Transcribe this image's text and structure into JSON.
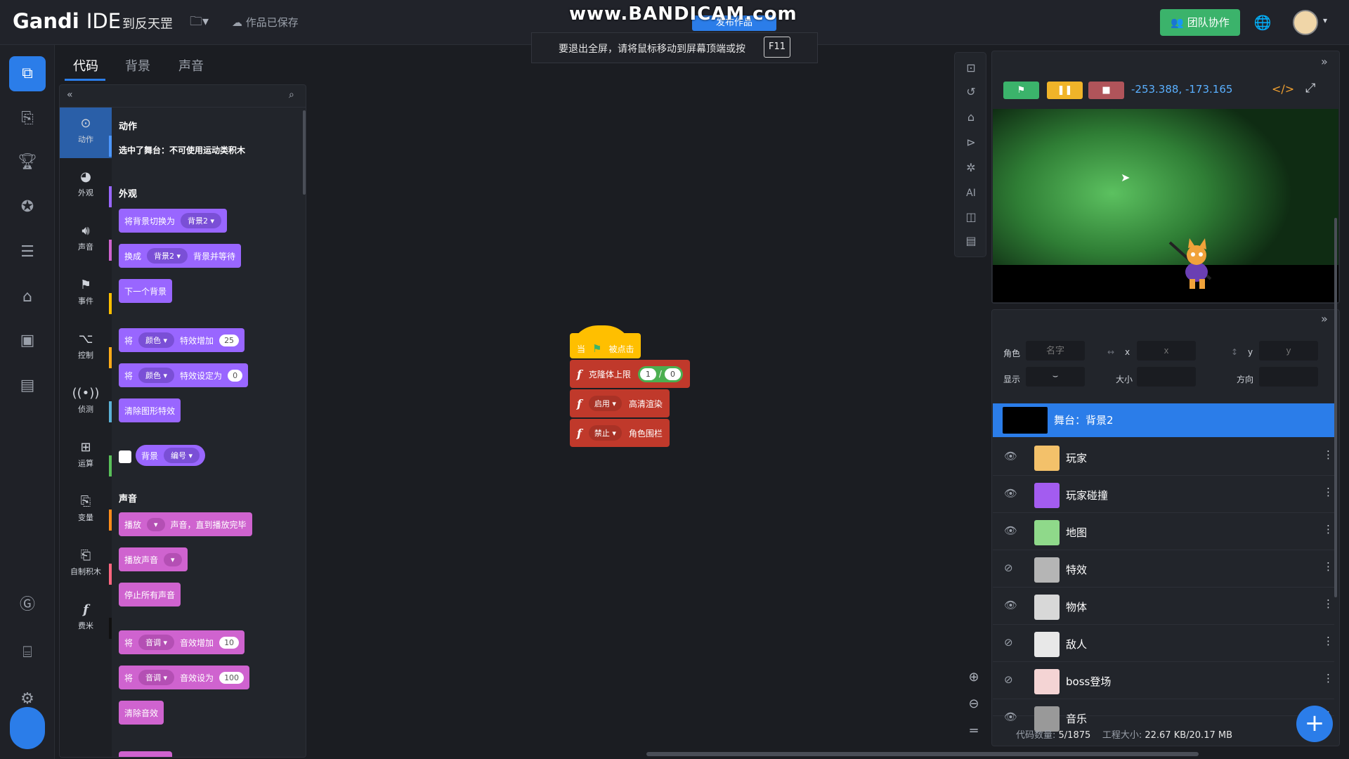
{
  "topbar": {
    "logo_main": "Gandi",
    "logo_sub": "IDE",
    "project_name": "到反天罡",
    "save_status": "作品已保存",
    "watermark": "www.BANDICAM.com",
    "publish_label": "发布作品",
    "fullscreen_tip": "要退出全屏，请将鼠标移动到屏幕顶端或按",
    "fullscreen_key": "F11",
    "team_button": "团队协作"
  },
  "tabs": [
    "代码",
    "背景",
    "声音"
  ],
  "palette": {
    "categories": [
      {
        "label": "动作",
        "icon": "motion-icon",
        "color": "#4c97ff"
      },
      {
        "label": "外观",
        "icon": "looks-icon",
        "color": "#9966ff"
      },
      {
        "label": "声音",
        "icon": "sound-icon",
        "color": "#cf63cf"
      },
      {
        "label": "事件",
        "icon": "events-icon",
        "color": "#ffbf00"
      },
      {
        "label": "控制",
        "icon": "control-icon",
        "color": "#ffab19"
      },
      {
        "label": "侦测",
        "icon": "sensing-icon",
        "color": "#5cb1d6"
      },
      {
        "label": "运算",
        "icon": "operators-icon",
        "color": "#59c059"
      },
      {
        "label": "变量",
        "icon": "variables-icon",
        "color": "#ff8c1a"
      },
      {
        "label": "自制积木",
        "icon": "myblocks-icon",
        "color": "#ff6680"
      },
      {
        "label": "费米",
        "icon": "fermi-icon",
        "color": "#111111"
      }
    ],
    "motion_title": "动作",
    "motion_note": "选中了舞台：不可使用运动类积木",
    "looks_title": "外观",
    "sound_title": "声音",
    "looks_blocks": {
      "switch_backdrop": "将背景切换为",
      "backdrop_name": "背景2",
      "switch_and_wait": "换成",
      "switch_and_wait_tail": "背景并等待",
      "next_backdrop": "下一个背景",
      "change_effect_prefix": "将",
      "effect_name": "颜色",
      "change_effect_mid": "特效增加",
      "change_effect_val": "25",
      "set_effect_mid": "特效设定为",
      "set_effect_val": "0",
      "clear_effects": "清除图形特效",
      "backdrop_reporter": "背景",
      "backdrop_reporter_opt": "编号"
    },
    "sound_blocks": {
      "play_until_done_prefix": "播放",
      "play_until_done_tail": "声音，直到播放完毕",
      "play_sound": "播放声音",
      "stop_all": "停止所有声音",
      "change_prefix": "将",
      "pitch": "音调",
      "change_mid": "音效增加",
      "change_val": "10",
      "set_mid": "音效设为",
      "set_val": "100",
      "clear_effects": "清除音效"
    }
  },
  "workspace": {
    "hat_label": "当",
    "hat_tail": "被点击",
    "clone_limit_label": "克隆体上限",
    "clone_a": "1",
    "clone_sep": "/",
    "clone_b": "0",
    "enable_opt": "启用",
    "hq_render": "高清渲染",
    "disable_opt": "禁止",
    "sprite_fence": "角色围栏"
  },
  "stage": {
    "coords": "-253.388, -173.165"
  },
  "sprite_panel": {
    "label_sprite": "角色",
    "placeholder_name": "名字",
    "label_x": "x",
    "placeholder_x": "x",
    "label_y": "y",
    "placeholder_y": "y",
    "label_show": "显示",
    "label_size": "大小",
    "label_direction": "方向",
    "stage_row": "舞台：背景2",
    "sprites": [
      {
        "name": "玩家",
        "visible": true,
        "thumb": "#f3c16a"
      },
      {
        "name": "玩家碰撞",
        "visible": true,
        "thumb": "#a35cf0"
      },
      {
        "name": "地图",
        "visible": true,
        "thumb": "#8fd98a"
      },
      {
        "name": "特效",
        "visible": false,
        "thumb": "#b5b5b5"
      },
      {
        "name": "物体",
        "visible": true,
        "thumb": "#d8d8d8"
      },
      {
        "name": "敌人",
        "visible": false,
        "thumb": "#e8e8e8"
      },
      {
        "name": "boss登场",
        "visible": false,
        "thumb": "#f4d4d4"
      },
      {
        "name": "音乐",
        "visible": true,
        "thumb": "#999999"
      }
    ],
    "footer_code_label": "代码数量:",
    "footer_code_value": "5/1875",
    "footer_size_label": "工程大小:",
    "footer_size_value": "22.67 KB/20.17 MB"
  },
  "colors": {
    "accent": "#2b7de9",
    "green": "#3bb36b",
    "looks": "#9966ff",
    "sound": "#cf63cf",
    "events": "#ffbf00",
    "extension_red": "#c0392b"
  }
}
